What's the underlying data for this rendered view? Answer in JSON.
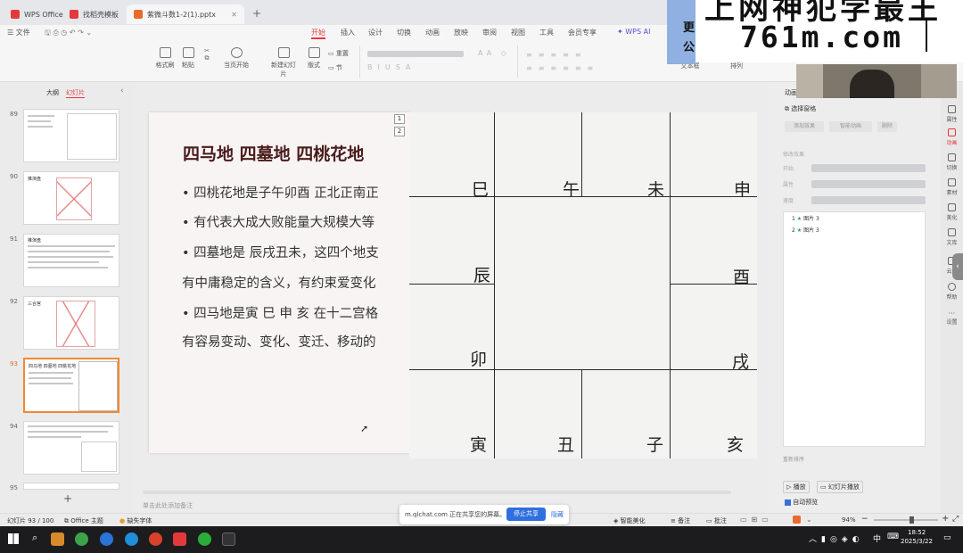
{
  "tabs": [
    {
      "label": "WPS Office"
    },
    {
      "label": "找稻壳模板"
    },
    {
      "label": "紫微斗数1-2(1).pptx"
    }
  ],
  "menu": {
    "file": "文件",
    "items": [
      "开始",
      "插入",
      "设计",
      "切换",
      "动画",
      "放映",
      "审阅",
      "视图",
      "工具",
      "会员专享"
    ],
    "wps_ai": "WPS AI"
  },
  "ribbon": {
    "format_painter": "格式刷",
    "paste": "粘贴",
    "play_from_current": "当页开始",
    "new_slide": "新建幻灯片",
    "layout": "版式",
    "section": "节",
    "reset": "重置",
    "textbox": "文本框",
    "arrange": "排列"
  },
  "left_panel": {
    "tab_outline": "大纲",
    "tab_slides": "幻灯片",
    "slides": [
      {
        "num": "89"
      },
      {
        "num": "90",
        "title": "推演盘"
      },
      {
        "num": "91",
        "title": "推演盘"
      },
      {
        "num": "92",
        "title": "三合宫"
      },
      {
        "num": "93",
        "title": "四马地 四墓地 四桃花地"
      },
      {
        "num": "94"
      },
      {
        "num": "95"
      }
    ]
  },
  "slide": {
    "title": "四马地  四墓地  四桃花地",
    "bullets": [
      "• 四桃花地是子午卯酉 正北正南正",
      "• 有代表大成大败能量大规模大等",
      "• 四墓地是 辰戌丑未，这四个地支",
      "  有中庸稳定的含义，有约束爱变化",
      "• 四马地是寅 巳 申 亥  在十二宫格",
      "  有容易变动、变化、变迁、移动的"
    ],
    "badges": [
      "1",
      "2"
    ],
    "notes_placeholder": "单击此处添加备注"
  },
  "grid": {
    "branches": [
      "巳",
      "午",
      "未",
      "申",
      "辰",
      "酉",
      "卯",
      "戌",
      "寅",
      "丑",
      "子",
      "亥"
    ]
  },
  "animation_pane": {
    "header": "动画",
    "select_pane": "选择窗格",
    "add_effect": "添加效果",
    "smart_anim": "智能动画",
    "delete": "删除",
    "modify": "修改效果",
    "start": "开始",
    "property": "属性",
    "speed": "速度",
    "items": [
      {
        "num": "1",
        "name": "图片 3"
      },
      {
        "num": "2",
        "name": "图片 3"
      }
    ],
    "reorder": "重新排序",
    "play": "播放",
    "slideshow": "幻灯片播放",
    "auto_preview": "自动预览"
  },
  "side_icons": [
    "属性",
    "动画",
    "切换",
    "素材",
    "美化",
    "文库",
    "云盘",
    "帮助",
    "设置"
  ],
  "status": {
    "slide_info": "幻灯片 93 / 100",
    "theme": "Office 主题",
    "font_missing": "缺失字体",
    "smart_beautify": "智能美化",
    "notes": "备注",
    "comments": "批注",
    "zoom": "94%"
  },
  "notification": {
    "text": "m.qlchat.com 正在共享您的屏幕。",
    "stop": "停止共享",
    "hide": "隐藏"
  },
  "taskbar": {
    "time": "18:52",
    "date": "2025/3/22",
    "ime": "中"
  },
  "watermark": {
    "line1": "上网神犯学最王",
    "line2": "761m.com",
    "corner1": "更",
    "corner2": "公"
  }
}
